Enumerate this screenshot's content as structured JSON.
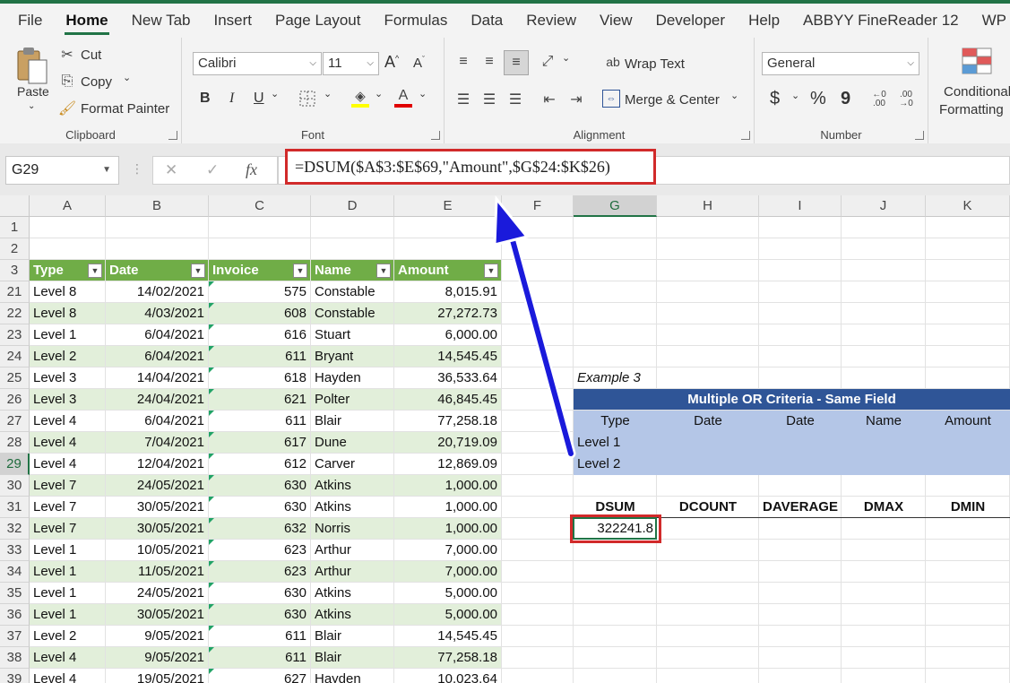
{
  "ribbon_tabs": [
    "File",
    "Home",
    "New Tab",
    "Insert",
    "Page Layout",
    "Formulas",
    "Data",
    "Review",
    "View",
    "Developer",
    "Help",
    "ABBYY FineReader 12",
    "WP"
  ],
  "active_tab": "Home",
  "clipboard": {
    "paste": "Paste",
    "cut": "Cut",
    "copy": "Copy",
    "format_painter": "Format Painter",
    "label": "Clipboard"
  },
  "font": {
    "name": "Calibri",
    "size": "11",
    "bold": "B",
    "italic": "I",
    "underline": "U",
    "label": "Font"
  },
  "alignment": {
    "wrap_text": "Wrap Text",
    "merge_center": "Merge & Center",
    "label": "Alignment"
  },
  "number": {
    "format": "General",
    "currency": "$",
    "percent": "%",
    "comma": "9",
    "label": "Number"
  },
  "styles": {
    "conditional_1": "Conditional",
    "conditional_2": "Formatting"
  },
  "formula_bar": {
    "name_box": "G29",
    "cancel": "✕",
    "enter": "✓",
    "fx": "fx",
    "formula": "=DSUM($A$3:$E$69,\"Amount\",$G$24:$K$26)"
  },
  "columns": [
    "A",
    "B",
    "C",
    "D",
    "E",
    "F",
    "G",
    "H",
    "I",
    "J",
    "K"
  ],
  "rows": [
    "1",
    "2",
    "3",
    "21",
    "22",
    "23",
    "24",
    "25",
    "26",
    "27",
    "28",
    "29",
    "30",
    "31",
    "32",
    "33",
    "34",
    "35",
    "36",
    "37",
    "38",
    "39"
  ],
  "table_headers": [
    "Type",
    "Date",
    "Invoice",
    "Name",
    "Amount"
  ],
  "table_rows": [
    [
      "Level 8",
      "14/02/2021",
      "575",
      "Constable",
      "8,015.91"
    ],
    [
      "Level 8",
      "4/03/2021",
      "608",
      "Constable",
      "27,272.73"
    ],
    [
      "Level 1",
      "6/04/2021",
      "616",
      "Stuart",
      "6,000.00"
    ],
    [
      "Level 2",
      "6/04/2021",
      "611",
      "Bryant",
      "14,545.45"
    ],
    [
      "Level 3",
      "14/04/2021",
      "618",
      "Hayden",
      "36,533.64"
    ],
    [
      "Level 3",
      "24/04/2021",
      "621",
      "Polter",
      "46,845.45"
    ],
    [
      "Level 4",
      "6/04/2021",
      "611",
      "Blair",
      "77,258.18"
    ],
    [
      "Level 4",
      "7/04/2021",
      "617",
      "Dune",
      "20,719.09"
    ],
    [
      "Level 4",
      "12/04/2021",
      "612",
      "Carver",
      "12,869.09"
    ],
    [
      "Level 7",
      "24/05/2021",
      "630",
      "Atkins",
      "1,000.00"
    ],
    [
      "Level 7",
      "30/05/2021",
      "630",
      "Atkins",
      "1,000.00"
    ],
    [
      "Level 7",
      "30/05/2021",
      "632",
      "Norris",
      "1,000.00"
    ],
    [
      "Level 1",
      "10/05/2021",
      "623",
      "Arthur",
      "7,000.00"
    ],
    [
      "Level 1",
      "11/05/2021",
      "623",
      "Arthur",
      "7,000.00"
    ],
    [
      "Level 1",
      "24/05/2021",
      "630",
      "Atkins",
      "5,000.00"
    ],
    [
      "Level 1",
      "30/05/2021",
      "630",
      "Atkins",
      "5,000.00"
    ],
    [
      "Level 2",
      "9/05/2021",
      "611",
      "Blair",
      "14,545.45"
    ],
    [
      "Level 4",
      "9/05/2021",
      "611",
      "Blair",
      "77,258.18"
    ],
    [
      "Level 4",
      "19/05/2021",
      "627",
      "Hayden",
      "10,023.64"
    ]
  ],
  "example": {
    "label": "Example 3",
    "title": "Multiple OR Criteria - Same Field",
    "criteria_headers": [
      "Type",
      "Date",
      "Date",
      "Name",
      "Amount"
    ],
    "criteria_values": [
      "Level 1",
      "Level 2"
    ],
    "function_headers": [
      "DSUM",
      "DCOUNT",
      "DAVERAGE",
      "DMAX",
      "DMIN"
    ],
    "dsum_result": "322241.8"
  },
  "colors": {
    "accent": "#217346",
    "table_header": "#70ad47",
    "band": "#e2efda",
    "criteria_title": "#2f5597",
    "criteria_fill": "#b4c6e7",
    "highlight": "#d12a2a",
    "arrow": "#1a1adb"
  }
}
